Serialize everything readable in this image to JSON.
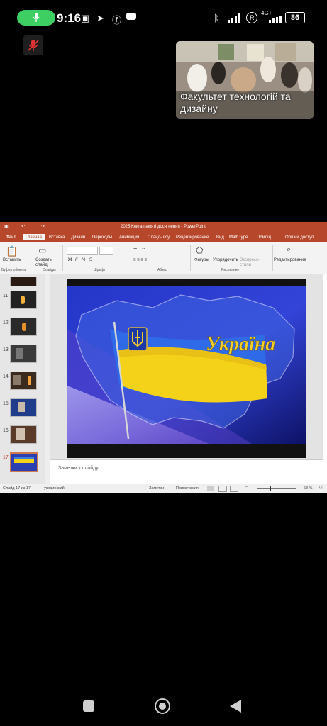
{
  "status_bar": {
    "time": "9:16",
    "battery": "86",
    "network": "4G+",
    "icons": [
      "mic-icon",
      "nfc-icon",
      "telegram-icon",
      "facebook-icon",
      "youtube-icon",
      "bluetooth-icon",
      "signal-icon",
      "registered-icon",
      "wifi-icon",
      "battery-icon"
    ]
  },
  "meeting": {
    "participant_label": "Факультет технологій та дизайну",
    "mic_state": "muted"
  },
  "powerpoint": {
    "title": "2025 Книга памяті досягнення - PowerPoint",
    "tabs": [
      "Файл",
      "Главная",
      "Вставка",
      "Дизайн",
      "Переходы",
      "Анимация",
      "Слайд-шоу",
      "Рецензирование",
      "Вид",
      "MathType"
    ],
    "help": "Помощ",
    "share": "Общий доступ",
    "ribbon": {
      "paste": "Вставить",
      "create_slide": "Создать слайд",
      "shapes": "Фигуры",
      "arrange": "Упорядочить",
      "express_styles": "Экспресс-стили",
      "editing": "Редактирование",
      "groups": [
        "Буфер обмена",
        "Слайды",
        "Шрифт",
        "Абзац",
        "Рисование"
      ]
    },
    "thumbnails": [
      "11",
      "12",
      "13",
      "14",
      "15",
      "16",
      "17"
    ],
    "selected_slide": "17",
    "slide_text": "Україна",
    "notes_placeholder": "Заметки к слайду",
    "status": {
      "slide_counter": "Слайд 17 из 17",
      "language": "украинский",
      "notes": "Заметки",
      "comments": "Примечания",
      "zoom": "68 %"
    }
  },
  "colors": {
    "ppt_brand": "#b7472a",
    "flag_blue": "#1f5ad6",
    "flag_yellow": "#f4d21a",
    "mic_pill": "#3ecf63"
  }
}
